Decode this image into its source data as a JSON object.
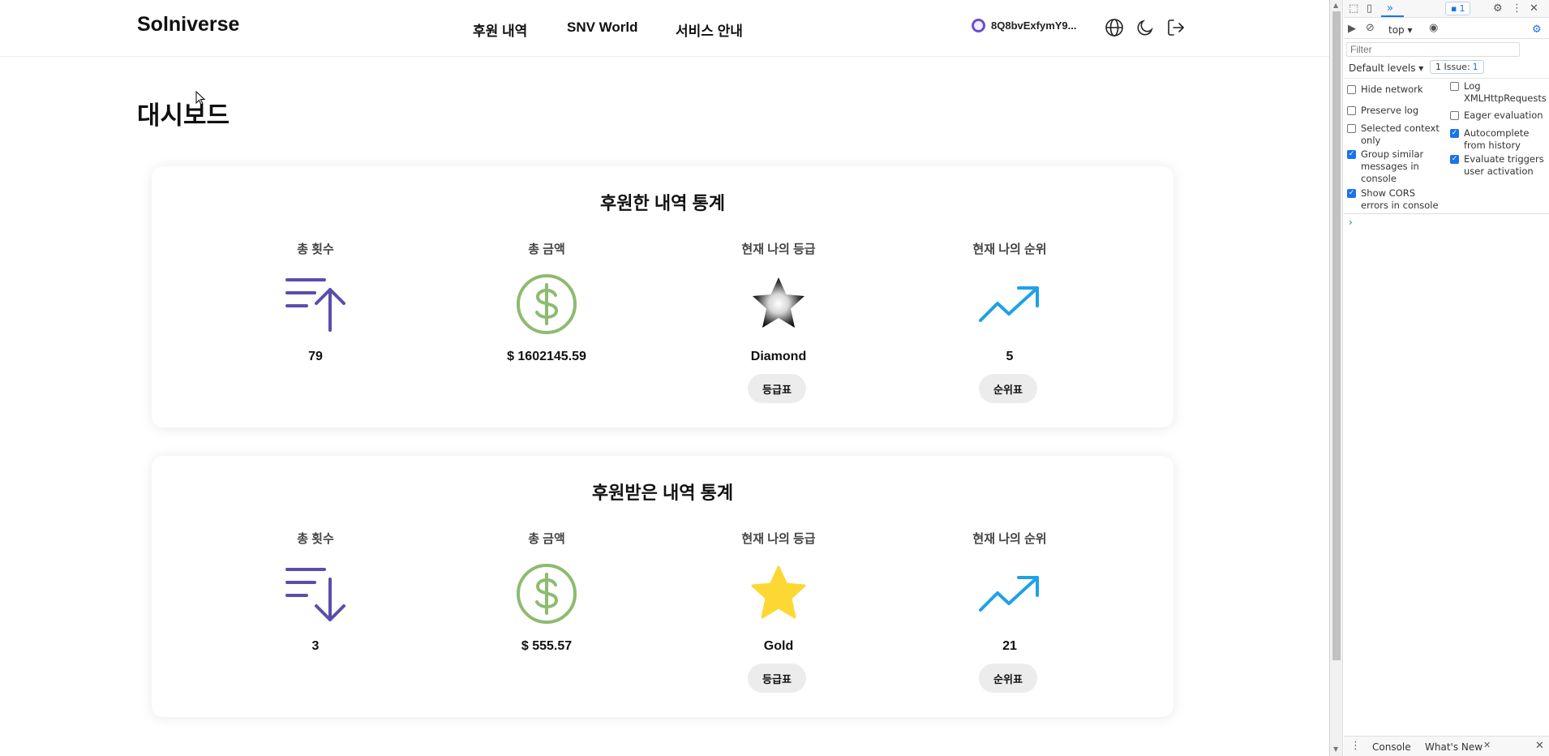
{
  "header": {
    "logo": "Solniverse",
    "nav": [
      "후원 내역",
      "SNV World",
      "서비스 안내"
    ],
    "wallet": "8Q8bvExfymY9...",
    "icons": [
      "globe-icon",
      "moon-icon",
      "logout-icon"
    ]
  },
  "page_title": "대시보드",
  "given": {
    "title": "후원한 내역 통계",
    "stats": [
      {
        "label": "총 횟수",
        "value": "79",
        "icon": "sort-up-icon"
      },
      {
        "label": "총 금액",
        "value": "$ 1602145.59",
        "icon": "dollar-icon"
      },
      {
        "label": "현재 나의 등급",
        "value": "Diamond",
        "icon": "diamond-star-icon",
        "button": "등급표"
      },
      {
        "label": "현재 나의 순위",
        "value": "5",
        "icon": "trend-up-icon",
        "button": "순위표"
      }
    ]
  },
  "received": {
    "title": "후원받은 내역 통계",
    "stats": [
      {
        "label": "총 횟수",
        "value": "3",
        "icon": "sort-down-icon"
      },
      {
        "label": "총 금액",
        "value": "$ 555.57",
        "icon": "dollar-icon"
      },
      {
        "label": "현재 나의 등급",
        "value": "Gold",
        "icon": "gold-star-icon",
        "button": "등급표"
      },
      {
        "label": "현재 나의 순위",
        "value": "21",
        "icon": "trend-up-icon",
        "button": "순위표"
      }
    ]
  },
  "colors": {
    "indigo": "#5b4eab",
    "green": "#8dbb6f",
    "gold": "#fdd835",
    "blue": "#1ea1e6",
    "accent": "#1a73e8"
  },
  "devtools": {
    "issues_badge": "1",
    "context": "top",
    "filter_placeholder": "Filter",
    "levels": "Default levels",
    "issues": "1 Issue:",
    "issues_count": "1",
    "options_left": [
      {
        "label": "Hide network",
        "checked": false
      },
      {
        "label": "Preserve log",
        "checked": false
      },
      {
        "label": "Selected context only",
        "checked": false
      },
      {
        "label": "Group similar messages in console",
        "checked": true
      },
      {
        "label": "Show CORS errors in console",
        "checked": true
      }
    ],
    "options_right": [
      {
        "label": "Log XMLHttpRequests",
        "checked": false
      },
      {
        "label": "Eager evaluation",
        "checked": false
      },
      {
        "label": "Autocomplete from history",
        "checked": true
      },
      {
        "label": "Evaluate triggers user activation",
        "checked": true
      }
    ],
    "bottom_tabs": [
      "Console",
      "What's New"
    ]
  }
}
